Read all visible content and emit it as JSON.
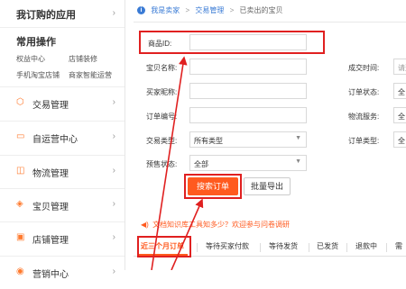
{
  "sidebar": {
    "top_title": "我订购的应用",
    "common_title": "常用操作",
    "links": [
      "权益中心",
      "店铺装修",
      "手机淘宝店铺",
      "商家智能运营"
    ],
    "menu": [
      {
        "icon": "hexagon-trade-icon",
        "label": "交易管理"
      },
      {
        "icon": "chat-icon",
        "label": "自运营中心"
      },
      {
        "icon": "box-icon",
        "label": "物流管理"
      },
      {
        "icon": "tag-icon",
        "label": "宝贝管理"
      },
      {
        "icon": "shop-icon",
        "label": "店铺管理"
      },
      {
        "icon": "marketing-icon",
        "label": "营销中心"
      }
    ]
  },
  "breadcrumb": {
    "items": [
      "我是卖家",
      "交易管理",
      "已卖出的宝贝"
    ]
  },
  "form": {
    "product_id_label": "商品ID:",
    "title_label": "宝贝名称:",
    "buyer_label": "买家昵称:",
    "order_no_label": "订单编号:",
    "trade_type_label": "交易类型:",
    "trade_type_value": "所有类型",
    "presale_label": "预售状态:",
    "presale_value": "全部",
    "deal_time_label": "成交时间:",
    "deal_time_placeholder": "请选",
    "order_status_label": "订单状态:",
    "order_status_value": "全",
    "logistics_label": "物流服务:",
    "logistics_value": "全",
    "order_type_label": "订单类型:",
    "order_type_value": "全"
  },
  "buttons": {
    "search": "搜索订单",
    "export": "批量导出"
  },
  "notice": "文档知识库工具知多少？欢迎参与问卷调研",
  "tabs": [
    "近三个月订单",
    "等待买家付款",
    "等待发货",
    "已发货",
    "退款中",
    "需"
  ],
  "colors": {
    "accent": "#ff5a1f",
    "highlight": "#e02020",
    "link": "#3a7bd5"
  }
}
